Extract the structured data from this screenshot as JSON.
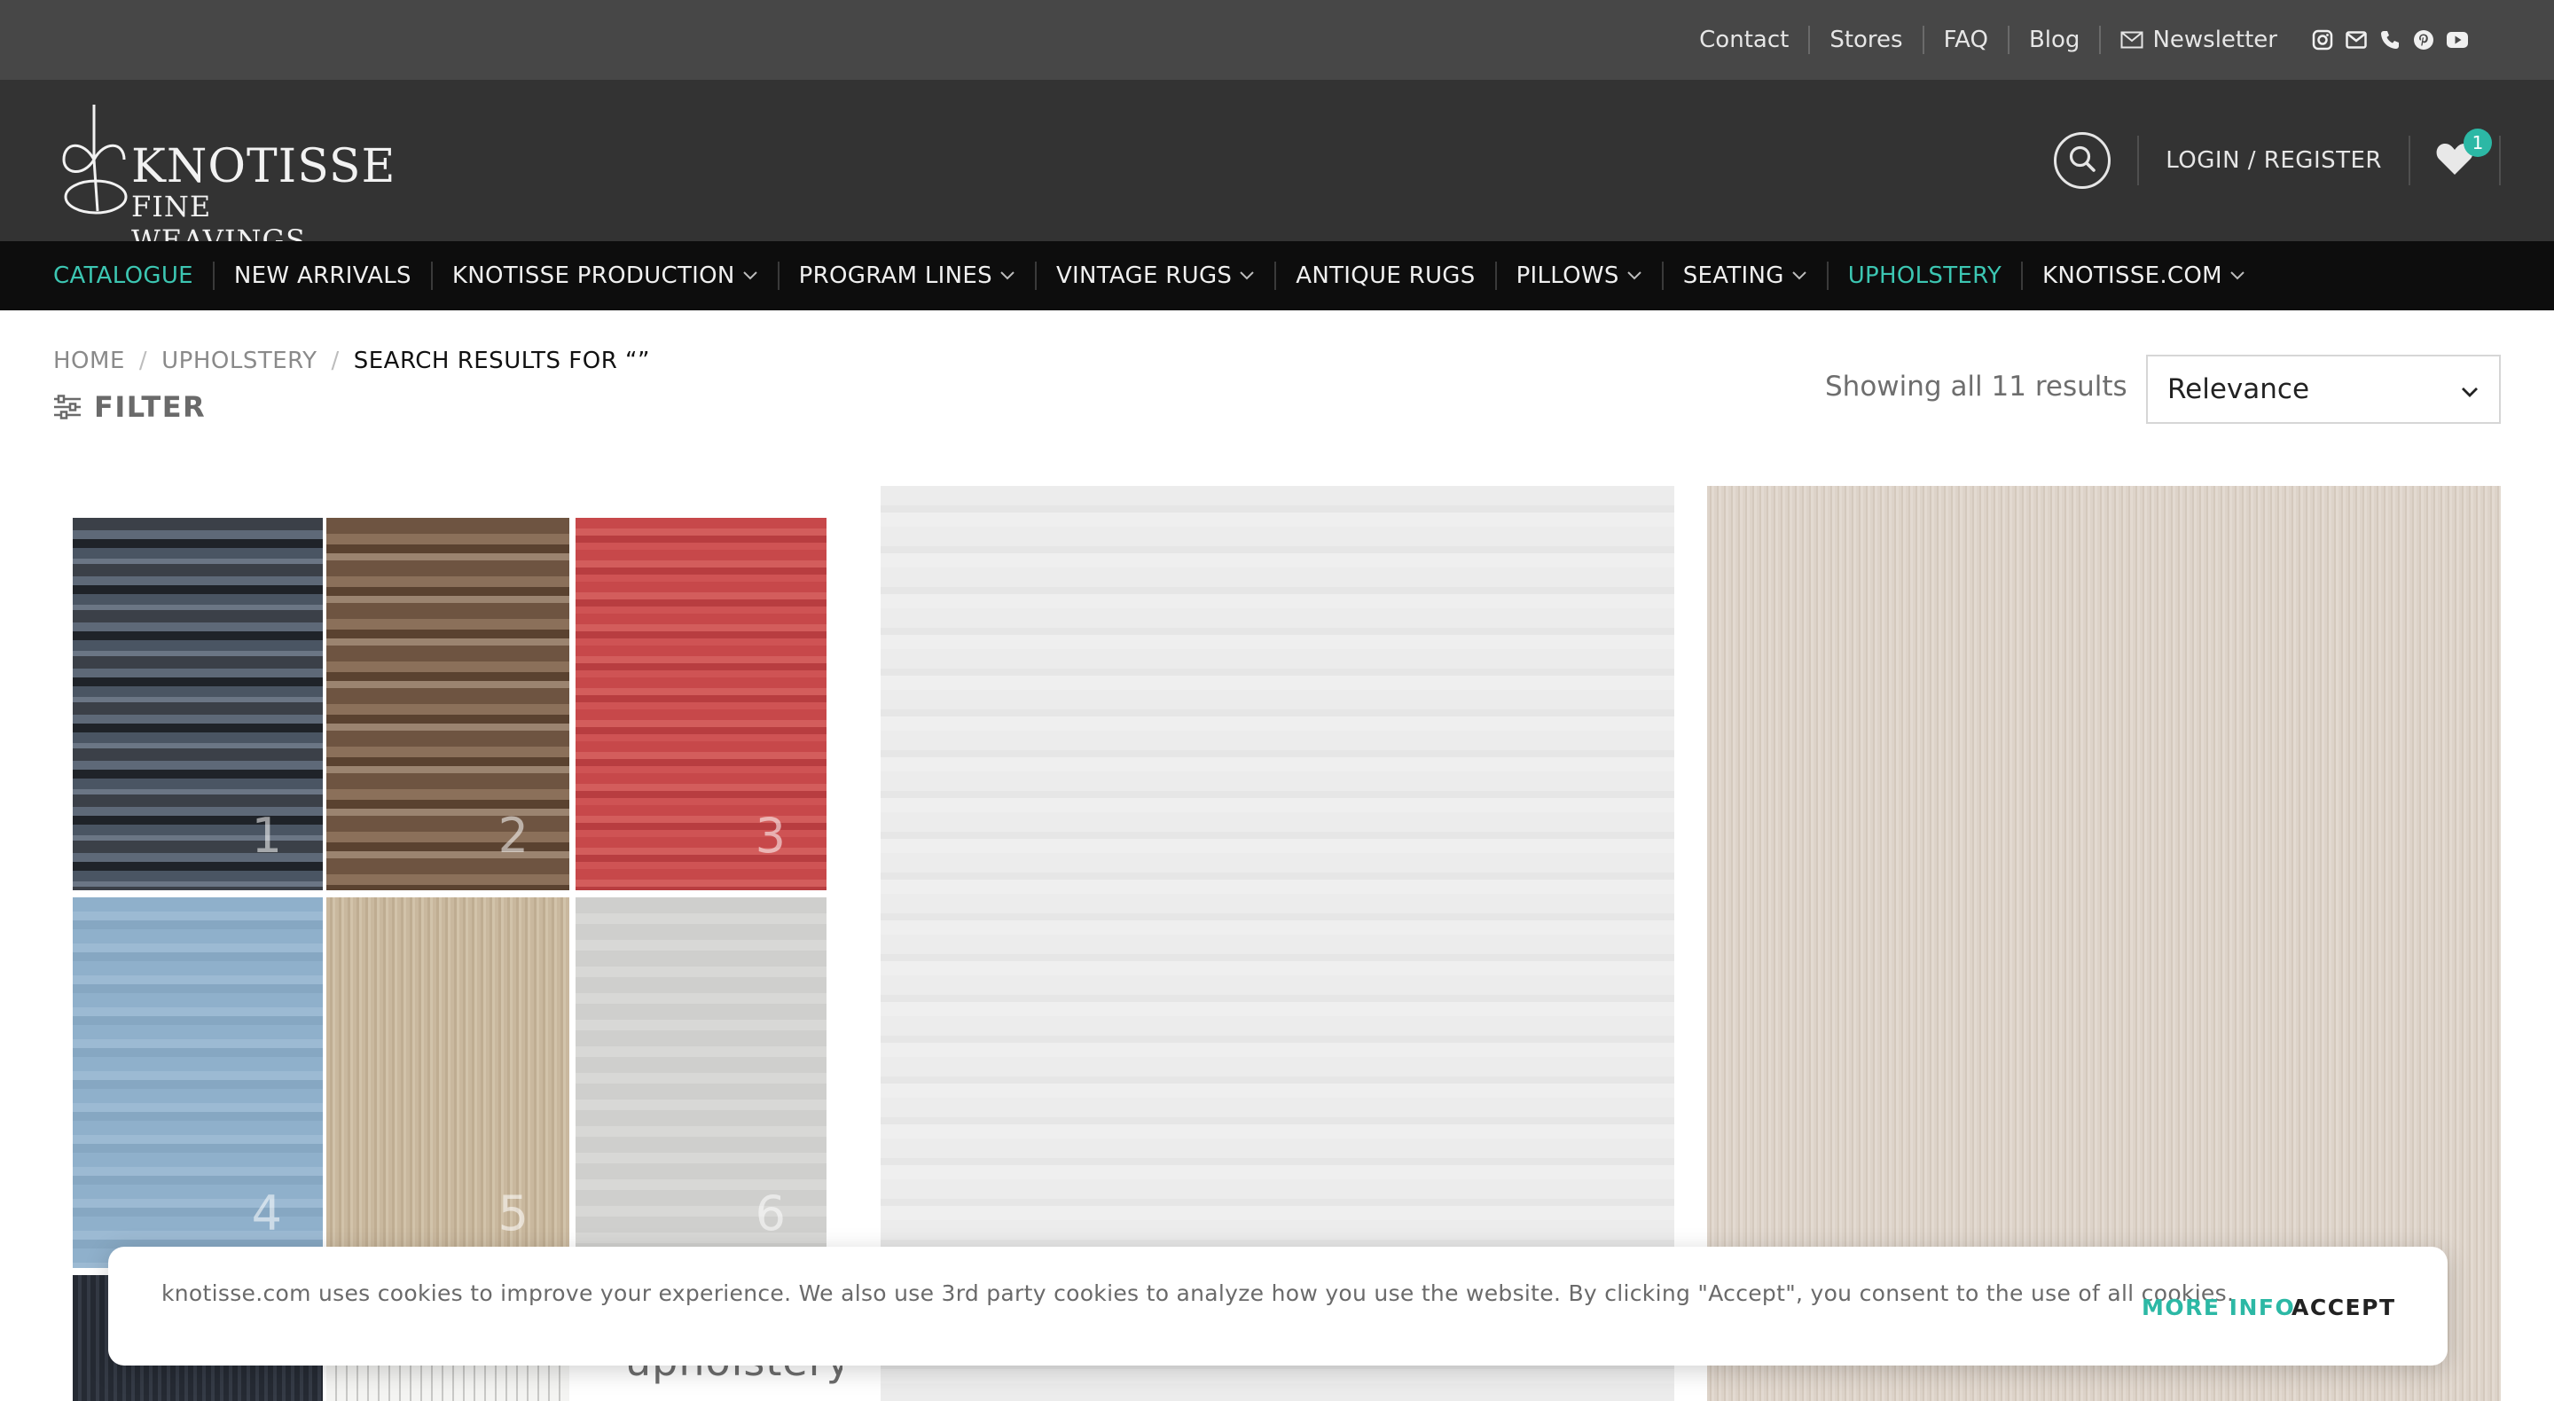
{
  "topbar": {
    "links": [
      "Contact",
      "Stores",
      "FAQ",
      "Blog"
    ],
    "newsletter_label": "Newsletter",
    "social_icons": [
      "instagram-icon",
      "email-icon",
      "phone-icon",
      "pinterest-icon",
      "youtube-icon"
    ]
  },
  "header": {
    "logo_name": "KNOTISSE",
    "logo_sub": "FINE WEAVINGS",
    "login_label": "LOGIN / REGISTER",
    "wishlist_count": "1"
  },
  "nav": {
    "items": [
      {
        "label": "CATALOGUE",
        "active": true,
        "dropdown": false
      },
      {
        "label": "NEW ARRIVALS",
        "active": false,
        "dropdown": false
      },
      {
        "label": "KNOTISSE PRODUCTION",
        "active": false,
        "dropdown": true
      },
      {
        "label": "PROGRAM LINES",
        "active": false,
        "dropdown": true
      },
      {
        "label": "VINTAGE RUGS",
        "active": false,
        "dropdown": true
      },
      {
        "label": "ANTIQUE RUGS",
        "active": false,
        "dropdown": false
      },
      {
        "label": "PILLOWS",
        "active": false,
        "dropdown": true
      },
      {
        "label": "SEATING",
        "active": false,
        "dropdown": true
      },
      {
        "label": "UPHOLSTERY",
        "active": true,
        "dropdown": false
      },
      {
        "label": "KNOTISSE.COM",
        "active": false,
        "dropdown": true
      }
    ]
  },
  "breadcrumb": {
    "home": "HOME",
    "category": "UPHOLSTERY",
    "current": "SEARCH RESULTS FOR “”"
  },
  "toolbar": {
    "filter_label": "FILTER",
    "results_text": "Showing all 11 results",
    "sort_value": "Relevance"
  },
  "products": {
    "swatch_numbers": [
      "1",
      "2",
      "3",
      "4",
      "5",
      "6"
    ],
    "upholstery_label": "upholstery"
  },
  "cookie": {
    "text": "knotisse.com uses cookies to improve your experience. We also use 3rd party cookies to analyze how you use the website. By clicking \"Accept\", you consent to the use of all cookies.",
    "more_info": "MORE INFO",
    "accept": "ACCEPT"
  },
  "colors": {
    "accent": "#3cc6b2",
    "topbar_bg": "#474747",
    "header_bg": "#333333",
    "nav_bg": "#0d0d0d"
  }
}
